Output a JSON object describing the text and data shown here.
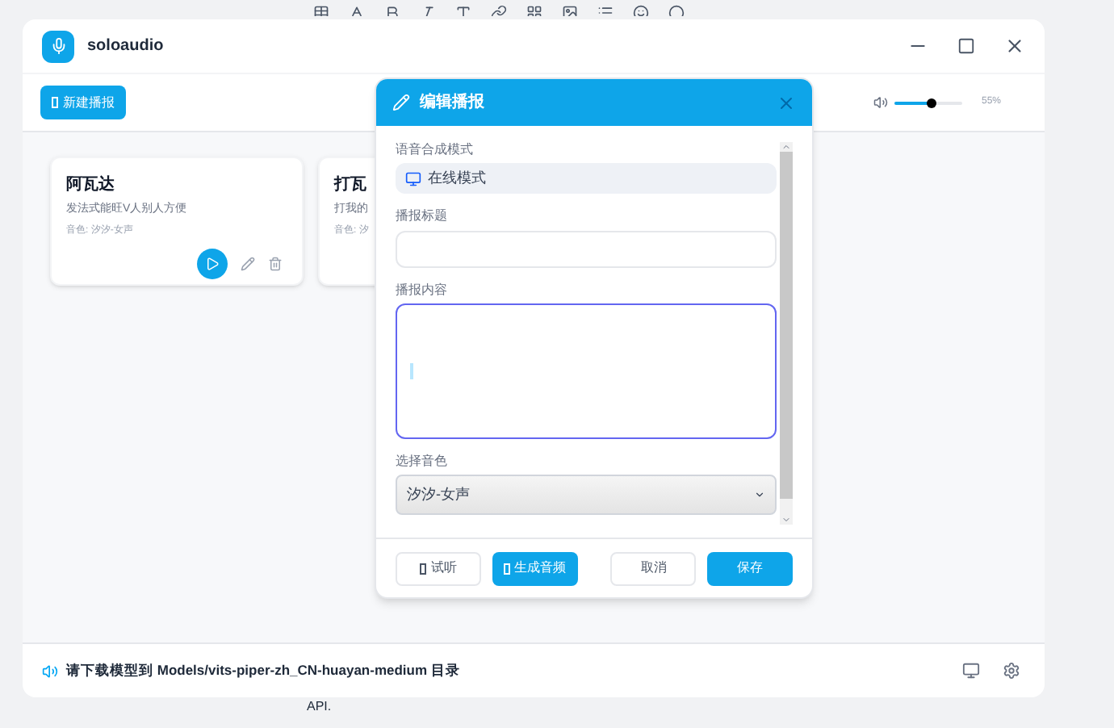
{
  "background": {
    "text": "API."
  },
  "app": {
    "title": "soloaudio"
  },
  "toolbar": {
    "new_button": "新建播报",
    "volume": {
      "level": 0.55,
      "reading": "55%"
    }
  },
  "cards": [
    {
      "title": "阿瓦达",
      "description": "发法式能旺V人别人方便",
      "voice": "音色: 汐汐-女声",
      "kind": "full"
    },
    {
      "title": "打瓦",
      "description": "打我的",
      "voice": "音色: 汐",
      "kind": "covered"
    }
  ],
  "dialog": {
    "title": "编辑播报",
    "fields": [
      {
        "kind": "mode",
        "label": "语音合成模式",
        "value": "在线模式"
      },
      {
        "kind": "input",
        "label": "播报标题"
      },
      {
        "kind": "textarea",
        "label": "播报内容",
        "focused": true
      },
      {
        "kind": "select",
        "label": "选择音色",
        "value": "汐汐-女声"
      }
    ],
    "buttons": [
      {
        "label": "试听",
        "kind": "outline",
        "icon": true
      },
      {
        "label": "生成音频",
        "kind": "primary",
        "icon": true
      },
      {
        "label": "取消",
        "kind": "outline",
        "icon": false
      },
      {
        "label": "保存",
        "kind": "primary",
        "icon": false
      }
    ]
  },
  "status_bar": {
    "message": "请下载模型到 Models/vits-piper-zh_CN-huayan-medium 目录"
  }
}
